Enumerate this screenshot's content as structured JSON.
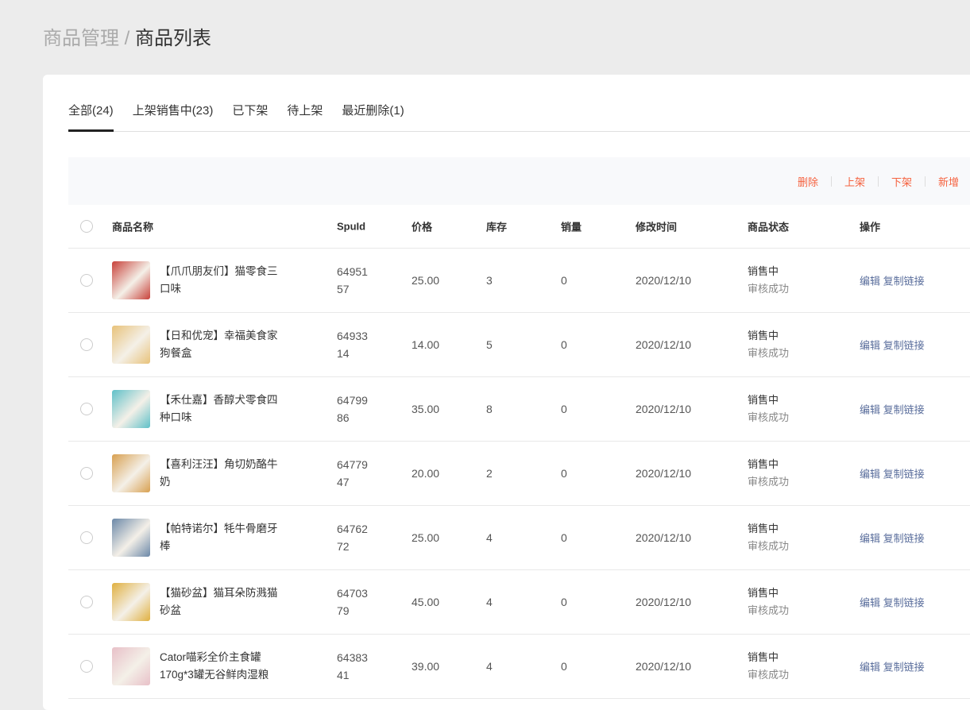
{
  "breadcrumb": {
    "parent": "商品管理",
    "separator": "/",
    "current": "商品列表"
  },
  "tabs": [
    "全部(24)",
    "上架销售中(23)",
    "已下架",
    "待上架",
    "最近删除(1)"
  ],
  "toolbar": {
    "delete": "删除",
    "list": "上架",
    "delist": "下架",
    "add": "新增"
  },
  "columns": {
    "name": "商品名称",
    "spuid": "SpuId",
    "price": "价格",
    "stock": "库存",
    "sales": "销量",
    "time": "修改时间",
    "status": "商品状态",
    "ops": "操作"
  },
  "rows": [
    {
      "name": "【爪爪朋友们】猫零食三口味",
      "spuid": "6495157",
      "price": "25.00",
      "stock": "3",
      "sales": "0",
      "time": "2020/12/10",
      "status": "销售中",
      "audit": "审核成功",
      "edit": "编辑",
      "copy": "复制链接",
      "img": "#c8413a"
    },
    {
      "name": "【日和优宠】幸福美食家狗餐盒",
      "spuid": "6493314",
      "price": "14.00",
      "stock": "5",
      "sales": "0",
      "time": "2020/12/10",
      "status": "销售中",
      "audit": "审核成功",
      "edit": "编辑",
      "copy": "复制链接",
      "img": "#e8c27a"
    },
    {
      "name": "【禾仕嘉】香醇犬零食四种口味",
      "spuid": "6479986",
      "price": "35.00",
      "stock": "8",
      "sales": "0",
      "time": "2020/12/10",
      "status": "销售中",
      "audit": "审核成功",
      "edit": "编辑",
      "copy": "复制链接",
      "img": "#5fc0c8"
    },
    {
      "name": "【喜利汪汪】角切奶酪牛奶",
      "spuid": "6477947",
      "price": "20.00",
      "stock": "2",
      "sales": "0",
      "time": "2020/12/10",
      "status": "销售中",
      "audit": "审核成功",
      "edit": "编辑",
      "copy": "复制链接",
      "img": "#d8a050"
    },
    {
      "name": "【帕特诺尔】牦牛骨磨牙棒",
      "spuid": "6476272",
      "price": "25.00",
      "stock": "4",
      "sales": "0",
      "time": "2020/12/10",
      "status": "销售中",
      "audit": "审核成功",
      "edit": "编辑",
      "copy": "复制链接",
      "img": "#6b88a8"
    },
    {
      "name": "【猫砂盆】猫耳朵防溅猫砂盆",
      "spuid": "6470379",
      "price": "45.00",
      "stock": "4",
      "sales": "0",
      "time": "2020/12/10",
      "status": "销售中",
      "audit": "审核成功",
      "edit": "编辑",
      "copy": "复制链接",
      "img": "#e0b040"
    },
    {
      "name": "Cator喵彩全价主食罐170g*3罐无谷鲜肉湿粮",
      "spuid": "6438341",
      "price": "39.00",
      "stock": "4",
      "sales": "0",
      "time": "2020/12/10",
      "status": "销售中",
      "audit": "审核成功",
      "edit": "编辑",
      "copy": "复制链接",
      "img": "#e8c0c8"
    }
  ]
}
